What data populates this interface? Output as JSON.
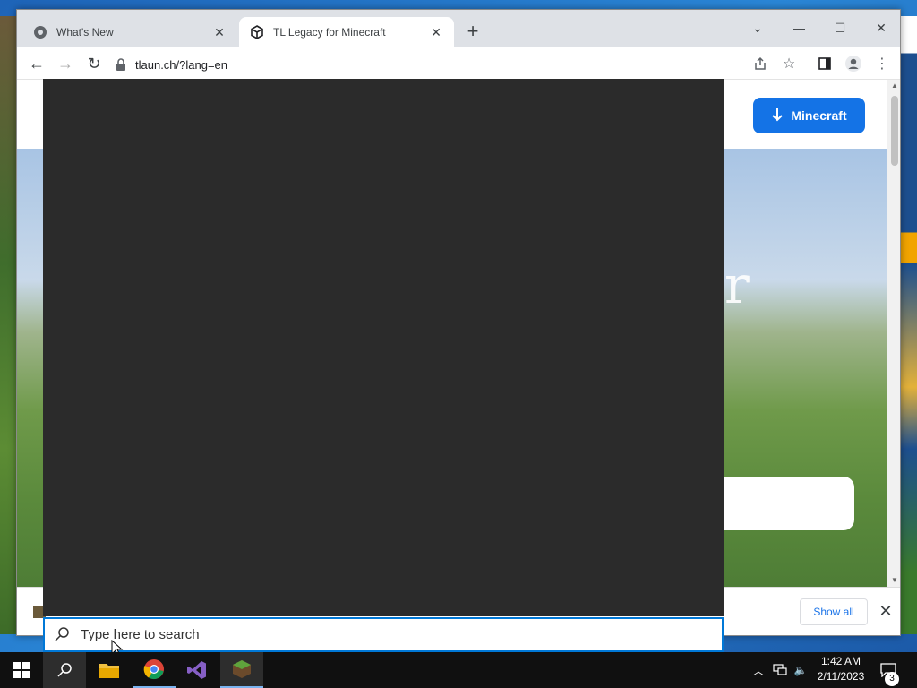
{
  "browser": {
    "tabs": [
      {
        "title": "What's New",
        "active": false
      },
      {
        "title": "TL Legacy for Minecraft",
        "active": true
      }
    ],
    "address": "tlaun.ch/?lang=en",
    "new_tab_symbol": "+"
  },
  "page": {
    "download_button_label": "Minecraft",
    "hero_partial_text": "r"
  },
  "downloads_bar": {
    "show_all_label": "Show all"
  },
  "search": {
    "placeholder": "Type here to search"
  },
  "taskbar": {
    "apps": [
      "start-icon",
      "search-icon",
      "file-explorer-icon",
      "chrome-icon",
      "visual-studio-icon",
      "minecraft-launcher-icon"
    ],
    "time": "1:42 AM",
    "date": "2/11/2023",
    "notification_count": "3"
  },
  "colors": {
    "accent": "#1473e6",
    "taskbar": "#101010",
    "search_panel": "#2b2b2b"
  }
}
